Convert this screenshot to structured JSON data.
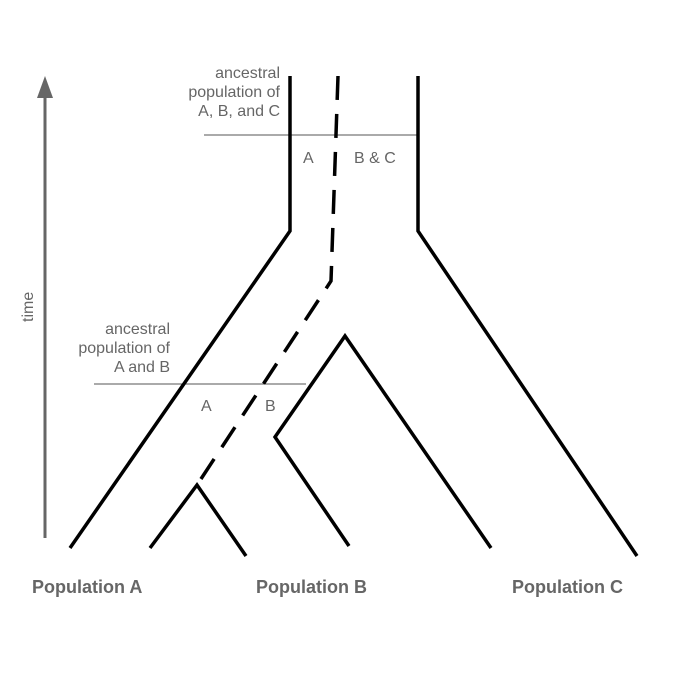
{
  "diagram": {
    "time_label": "time",
    "ancestral_abc": [
      "ancestral",
      "population of",
      "A, B, and C"
    ],
    "ancestral_ab": [
      "ancestral",
      "population of",
      "A and B"
    ],
    "upper_section_labels": {
      "left": "A",
      "right": "B & C"
    },
    "lower_section_labels": {
      "left": "A",
      "right": "B"
    },
    "populations": [
      "Population A",
      "Population B",
      "Population C"
    ],
    "colors": {
      "tree": "#000000",
      "text": "#666666",
      "arrow": "#666666",
      "section_line": "#555555"
    }
  }
}
